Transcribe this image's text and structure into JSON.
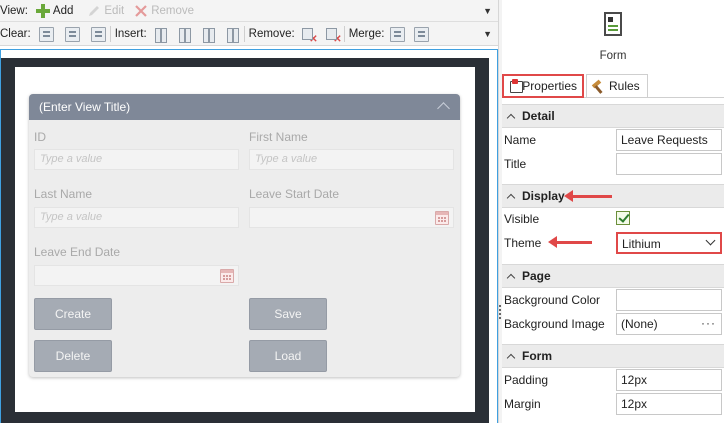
{
  "toolbar": {
    "view_label": "View:",
    "add_label": "Add",
    "edit_label": "Edit",
    "remove_label": "Remove",
    "clear_label": "Clear:",
    "insert_label": "Insert:",
    "remove2_label": "Remove:",
    "merge_label": "Merge:"
  },
  "view": {
    "title": "(Enter View Title)",
    "fields": [
      {
        "label": "ID",
        "placeholder": "Type a value"
      },
      {
        "label": "First Name",
        "placeholder": "Type a value"
      },
      {
        "label": "Last Name",
        "placeholder": "Type a value"
      },
      {
        "label": "Leave Start Date",
        "placeholder": ""
      },
      {
        "label": "Leave End Date",
        "placeholder": ""
      }
    ],
    "buttons": {
      "create": "Create",
      "save": "Save",
      "delete": "Delete",
      "load": "Load"
    }
  },
  "panel": {
    "header_title": "Form",
    "tabs": {
      "properties": "Properties",
      "rules": "Rules"
    },
    "sections": {
      "detail": "Detail",
      "display": "Display",
      "page": "Page",
      "form": "Form"
    },
    "props": {
      "name_label": "Name",
      "name_value": "Leave Requests",
      "title_label": "Title",
      "title_value": "",
      "visible_label": "Visible",
      "visible_checked": true,
      "theme_label": "Theme",
      "theme_value": "Lithium",
      "bg_color_label": "Background Color",
      "bg_color_value": "",
      "bg_image_label": "Background Image",
      "bg_image_value": "(None)",
      "ellipsis": "···",
      "padding_label": "Padding",
      "padding_value": "12px",
      "margin_label": "Margin",
      "margin_value": "12px"
    }
  },
  "colors": {
    "highlight": "#e04848",
    "panel_header": "#7f8898",
    "canvas_bg": "#2a2f36",
    "selection_border": "#3fa0e0"
  },
  "icons": [
    "add-icon",
    "edit-icon",
    "remove-icon",
    "form-icon",
    "properties-icon",
    "rules-icon",
    "calendar-icon",
    "chevron-up-icon",
    "checkbox-checked-icon",
    "dropdown-arrow-icon"
  ]
}
